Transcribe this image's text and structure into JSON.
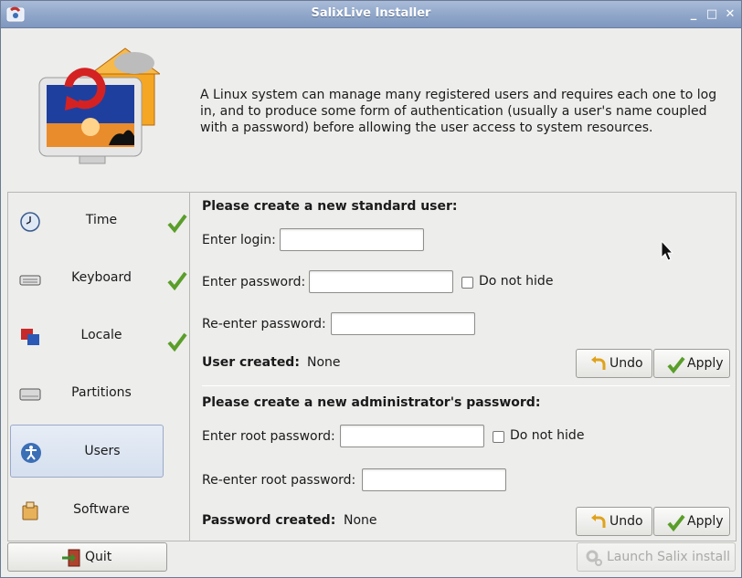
{
  "window": {
    "title": "SalixLive Installer"
  },
  "intro": "A Linux system can manage many registered users and requires each one to log in, and to produce some form of authentication (usually a user's name coupled with a password) before allowing the user access to system resources.",
  "sidebar": {
    "items": [
      {
        "label": "Time",
        "icon": "clock-icon",
        "done": true
      },
      {
        "label": "Keyboard",
        "icon": "keyboard-icon",
        "done": true
      },
      {
        "label": "Locale",
        "icon": "flags-icon",
        "done": true
      },
      {
        "label": "Partitions",
        "icon": "harddisk-icon",
        "done": false
      },
      {
        "label": "Users",
        "icon": "user-icon",
        "done": false,
        "selected": true
      },
      {
        "label": "Software",
        "icon": "package-icon",
        "done": false
      }
    ]
  },
  "user_section": {
    "heading": "Please create a new standard user:",
    "login_label": "Enter login:",
    "login_value": "",
    "password_label": "Enter password:",
    "password_value": "",
    "do_not_hide_label": "Do not hide",
    "reenter_label": "Re-enter password:",
    "reenter_value": "",
    "status_label": "User created:",
    "status_value": "None",
    "undo_label": "Undo",
    "apply_label": "Apply"
  },
  "root_section": {
    "heading": "Please create a new administrator's password:",
    "password_label": "Enter root password:",
    "password_value": "",
    "do_not_hide_label": "Do not hide",
    "reenter_label": "Re-enter root password:",
    "reenter_value": "",
    "status_label": "Password created:",
    "status_value": "None",
    "undo_label": "Undo",
    "apply_label": "Apply"
  },
  "footer": {
    "quit_label": "Quit",
    "launch_label": "Launch Salix install"
  },
  "colors": {
    "titlebar": "#8fa6c9",
    "check": "#5a9e2a",
    "selection": "#d5dfee"
  }
}
